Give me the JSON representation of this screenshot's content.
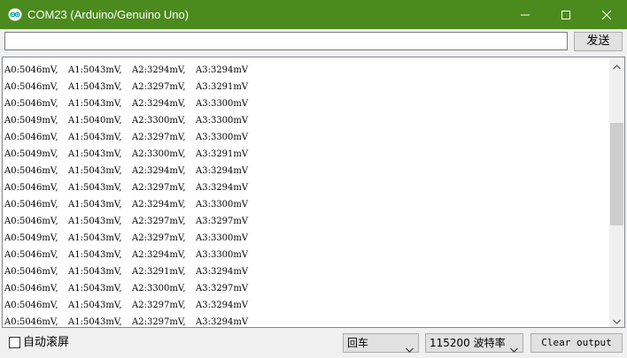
{
  "window": {
    "title": "COM23 (Arduino/Genuino Uno)"
  },
  "toolbar": {
    "send_value": "",
    "send_label": "发送"
  },
  "output_lines": [
    [
      "A0:5046mV,",
      "A1:5043mV,",
      "A2:3294mV,",
      "A3:3294mV"
    ],
    [
      "A0:5046mV,",
      "A1:5043mV,",
      "A2:3297mV,",
      "A3:3291mV"
    ],
    [
      "A0:5046mV,",
      "A1:5043mV,",
      "A2:3294mV,",
      "A3:3300mV"
    ],
    [
      "A0:5049mV,",
      "A1:5040mV,",
      "A2:3300mV,",
      "A3:3300mV"
    ],
    [
      "A0:5046mV,",
      "A1:5043mV,",
      "A2:3297mV,",
      "A3:3300mV"
    ],
    [
      "A0:5049mV,",
      "A1:5043mV,",
      "A2:3300mV,",
      "A3:3291mV"
    ],
    [
      "A0:5046mV,",
      "A1:5043mV,",
      "A2:3294mV,",
      "A3:3294mV"
    ],
    [
      "A0:5046mV,",
      "A1:5043mV,",
      "A2:3297mV,",
      "A3:3294mV"
    ],
    [
      "A0:5046mV,",
      "A1:5043mV,",
      "A2:3294mV,",
      "A3:3300mV"
    ],
    [
      "A0:5046mV,",
      "A1:5043mV,",
      "A2:3297mV,",
      "A3:3297mV"
    ],
    [
      "A0:5049mV,",
      "A1:5043mV,",
      "A2:3297mV,",
      "A3:3300mV"
    ],
    [
      "A0:5046mV,",
      "A1:5043mV,",
      "A2:3294mV,",
      "A3:3300mV"
    ],
    [
      "A0:5046mV,",
      "A1:5043mV,",
      "A2:3291mV,",
      "A3:3294mV"
    ],
    [
      "A0:5046mV,",
      "A1:5043mV,",
      "A2:3300mV,",
      "A3:3297mV"
    ],
    [
      "A0:5046mV,",
      "A1:5043mV,",
      "A2:3297mV,",
      "A3:3294mV"
    ],
    [
      "A0:5046mV,",
      "A1:5043mV,",
      "A2:3297mV,",
      "A3:3294mV"
    ]
  ],
  "bottom": {
    "autoscroll_label": "自动滚屏",
    "autoscroll_checked": false,
    "line_ending": "回车",
    "baud_rate": "115200 波特率",
    "clear_label": "Clear output"
  },
  "colors": {
    "titlebar": "#4b8a1c",
    "scroll_thumb": "#cdcdcd"
  },
  "icons": {
    "app": "arduino-logo-icon",
    "minimize": "minimize-icon",
    "maximize": "maximize-icon",
    "close": "close-icon",
    "scroll_up": "chevron-up-icon",
    "scroll_down": "chevron-down-icon",
    "dropdown": "chevron-down-icon"
  }
}
